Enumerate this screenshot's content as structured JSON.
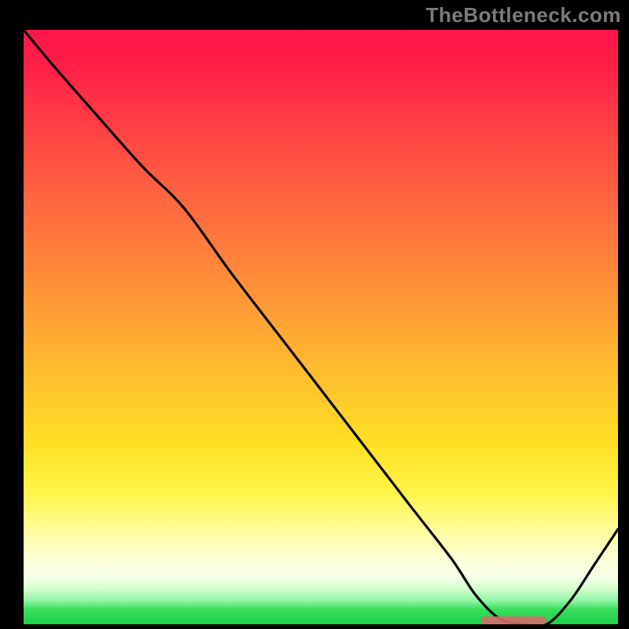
{
  "watermark": {
    "text": "TheBottleneck.com"
  },
  "colors": {
    "black": "#000000",
    "curve_stroke": "#000000",
    "marker": "#d86a6a",
    "gradient_top": "#ff1549",
    "gradient_mid": "#ffe126",
    "gradient_bottom": "#19d14a",
    "watermark_text": "#7b7b7b"
  },
  "chart_data": {
    "type": "line",
    "title": "",
    "xlabel": "",
    "ylabel": "",
    "xlim": [
      0,
      100
    ],
    "ylim": [
      0,
      100
    ],
    "grid": false,
    "legend": false,
    "background": "heatmap-gradient-vertical",
    "series": [
      {
        "name": "bottleneck-curve",
        "x": [
          0,
          5,
          12,
          20,
          27,
          35,
          45,
          55,
          65,
          72,
          76,
          80,
          84,
          88,
          92,
          96,
          100
        ],
        "y": [
          100,
          94,
          86,
          77,
          70,
          59,
          46,
          33,
          20,
          11,
          5,
          1,
          0,
          0,
          4,
          10,
          16
        ]
      }
    ],
    "annotations": [
      {
        "name": "optimal-range-marker",
        "type": "hbar",
        "x_start": 77,
        "x_end": 88,
        "y": 0.5
      }
    ],
    "notes": "No axis ticks or numeric labels are rendered; x and y are normalized 0–100 percent of plot area. Curve values estimated from pixel positions."
  }
}
